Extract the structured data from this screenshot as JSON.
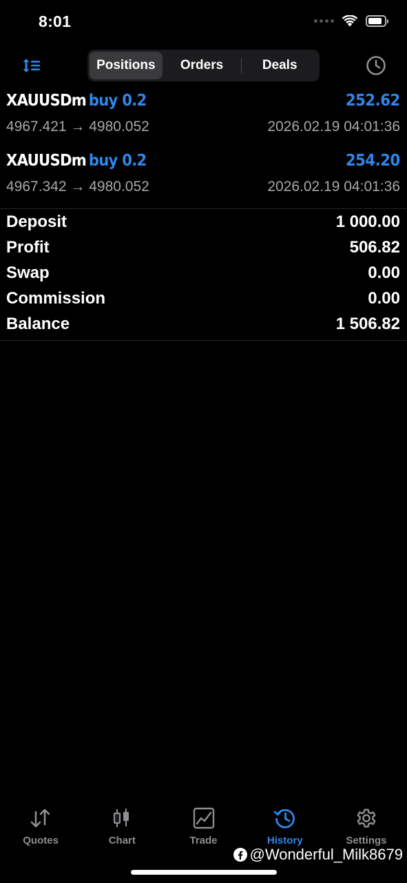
{
  "status_bar": {
    "time": "8:01",
    "battery_level": 0.85
  },
  "segmented_control": {
    "tabs": [
      {
        "label": "Positions",
        "active": true
      },
      {
        "label": "Orders",
        "active": false
      },
      {
        "label": "Deals",
        "active": false
      }
    ]
  },
  "deals": [
    {
      "symbol": "XAUUSDm",
      "side": "buy 0.2",
      "profit": "252.62",
      "prices": "4967.421 → 4980.052",
      "time": "2026.02.19 04:01:36"
    },
    {
      "symbol": "XAUUSDm",
      "side": "buy 0.2",
      "profit": "254.20",
      "prices": "4967.342 → 4980.052",
      "time": "2026.02.19 04:01:36"
    }
  ],
  "summary": [
    {
      "label": "Deposit",
      "value": "1 000.00"
    },
    {
      "label": "Profit",
      "value": "506.82"
    },
    {
      "label": "Swap",
      "value": "0.00"
    },
    {
      "label": "Commission",
      "value": "0.00"
    },
    {
      "label": "Balance",
      "value": "1 506.82"
    }
  ],
  "tabbar": {
    "tabs": [
      {
        "label": "Quotes",
        "icon": "quotes-arrows-icon",
        "active": false
      },
      {
        "label": "Chart",
        "icon": "candlestick-chart-icon",
        "active": false
      },
      {
        "label": "Trade",
        "icon": "trade-line-chart-icon",
        "active": false
      },
      {
        "label": "History",
        "icon": "history-clock-icon",
        "active": true
      },
      {
        "label": "Settings",
        "icon": "gear-icon",
        "active": false
      }
    ]
  },
  "watermark": {
    "text": "@Wonderful_Milk8679"
  },
  "colors": {
    "accent": "#2f86ea",
    "background": "#000000",
    "secondary_text": "#a8a8a8",
    "inactive_tab": "#8e8e93"
  }
}
